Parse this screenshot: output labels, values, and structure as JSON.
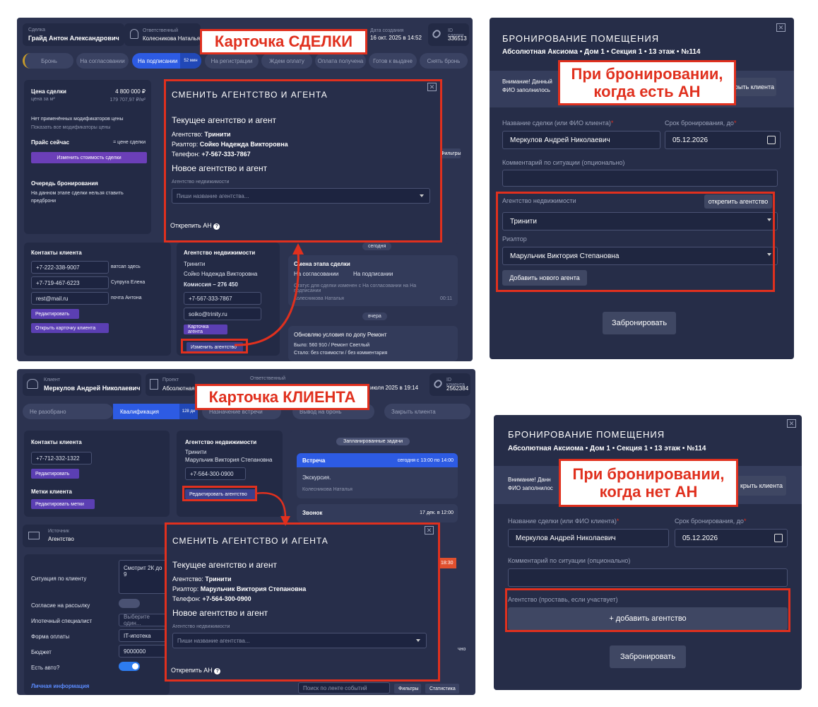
{
  "callouts": {
    "deal": "Карточка СДЕЛКИ",
    "client": "Карточка КЛИЕНТА",
    "with_an": "При бронировании,\nкогда есть АН",
    "without_an": "При бронировании,\nкогда нет АН"
  },
  "deal": {
    "header": {
      "deal_label": "Сделка",
      "deal_name": "Грайд Антон Александрович",
      "resp_label": "Ответственный",
      "resp_name": "Колесникова Наталья",
      "created_label": "Дата создания",
      "created": "16 окт. 2025 в 14:52",
      "id_label": "ID сделки",
      "id": "336513"
    },
    "stages": [
      "Бронь",
      "На согласовании",
      "На подписании",
      "52 мин",
      "На регистрации",
      "Ждем оплату",
      "Оплата получена",
      "Готов к выдаче",
      "Снять бронь"
    ],
    "price": {
      "title": "Цена сделки",
      "value": "4 800 000 ₽",
      "sub": "цена за м²",
      "per_m": "179 707,97 ₽/м²",
      "no_mod": "Нет применённых модификаторов цены",
      "show_mod": "Показать все модификаторы цены",
      "now": "Прайс сейчас",
      "now_val": "= цене сделки",
      "change_btn": "Изменить стоимость сделки"
    },
    "queue": {
      "title": "Очередь бронирования",
      "text": "На данном этапе сделки нельзя ставить предброни"
    },
    "contacts": {
      "title": "Контакты клиента",
      "rows": [
        {
          "v": "+7-222-338-9007",
          "n": "ватсап здесь"
        },
        {
          "v": "+7-719-467-6223",
          "n": "Супруга Елена"
        },
        {
          "v": "rest@mail.ru",
          "n": "почта Антона"
        }
      ],
      "edit": "Редактировать",
      "open": "Открыть карточку клиента"
    },
    "agency": {
      "title": "Агентство недвижимости",
      "name": "Тринити",
      "agent": "Сойко Надежда Викторовна",
      "commission": "Комиссия – 276 450",
      "phone": "+7-567-333-7867",
      "email": "soiko@trinity.ru",
      "card_btn": "Карточка агента",
      "change_btn": "Изменить агентство"
    },
    "feed": {
      "filters": "Фильтры",
      "today": "сегодня",
      "stage_title": "Смена этапа сделки",
      "from": "На согласовании",
      "to": "На подписании",
      "status": "Статус для сделки изменен с На согласовании на На подписании",
      "who": "Колесникова Наталья",
      "time": "00:11",
      "yesterday": "вчера",
      "upd": "Обновляю условия по допу Ремонт",
      "was": "Было: 560 910 / Ремонт Светлый",
      "now": "Стало: без стоимости / без комментария"
    },
    "modal": {
      "title": "СМЕНИТЬ АГЕНТСТВО И АГЕНТА",
      "cur": "Текущее агентство и агент",
      "agency": "Агентство:",
      "agency_v": "Тринити",
      "agent": "Риэлтор:",
      "agent_v": "Сойко Надежда Викторовна",
      "phone": "Телефон:",
      "phone_v": "+7-567-333-7867",
      "new": "Новое агентство и агент",
      "field_label": "Агентство недвижимости",
      "placeholder": "Пиши название агентства...",
      "unpin": "Открепить АН"
    }
  },
  "client": {
    "header": {
      "client_label": "Клиент",
      "client_name": "Меркулов Андрей Николаевич",
      "project_label": "Проект",
      "project": "Абсолютная",
      "resp_label": "Ответственный",
      "created": "июля 2025 в 19:14",
      "id_label": "ID клиента",
      "id": "2562384"
    },
    "stages": [
      "Не разобрано",
      "Квалификация",
      "128 дн",
      "Назначение встречи",
      "Вывод на бронь",
      "Закрыть клиента"
    ],
    "contacts": {
      "title": "Контакты клиента",
      "phone": "+7-712-332-1322",
      "edit": "Редактировать",
      "tags": "Метки клиента",
      "edit_tags": "Редактировать метки"
    },
    "agency": {
      "title": "Агентство недвижимости",
      "name": "Тринити",
      "agent": "Марульчик Виктория Степановна",
      "phone": "+7-564-300-0900",
      "edit_btn": "Редактировать агентство"
    },
    "tasks": {
      "header": "Запланированные задачи",
      "meet": "Встреча",
      "meet_time": "сегодня с 13:00 по 14:00",
      "meet_text": "Экскурсия.",
      "meet_who": "Колесникова Наталья",
      "call": "Звонок",
      "call_time": "17 дек. в 12:00",
      "late": "18:30"
    },
    "source": {
      "label": "Источник",
      "value": "Агентство"
    },
    "form": {
      "situation": "Ситуация по клиенту",
      "situation_v": "Смотрит 2К до 9",
      "mail": "Согласие на рассылку",
      "mortgage": "Ипотечный специалист",
      "mortgage_ph": "Выберите один...",
      "pay": "Форма оплаты",
      "pay_v": "IT-ипотека",
      "budget": "Бюджет",
      "budget_v": "9000000",
      "car": "Есть авто?",
      "personal": "Личная информация"
    },
    "feed": {
      "search": "Поиск по ленте событий",
      "filters": "Фильтры",
      "stats": "Статистика",
      "chno": "чно"
    },
    "modal": {
      "title": "СМЕНИТЬ АГЕНТСТВО И АГЕНТА",
      "cur": "Текущее агентство и агент",
      "agency": "Агентство:",
      "agency_v": "Тринити",
      "agent": "Риэлтор:",
      "agent_v": "Марульчик Виктория Степановна",
      "phone": "Телефон:",
      "phone_v": "+7-564-300-0900",
      "new": "Новое агентство и агент",
      "field_label": "Агентство недвижимости",
      "placeholder": "Пиши название агентства...",
      "unpin": "Открепить АН"
    }
  },
  "booking1": {
    "title": "БРОНИРОВАНИЕ ПОМЕЩЕНИЯ",
    "sub": "Абсолютная Аксиома • Дом 1 • Секция 1 • 13 этаж • №114",
    "warn": "Внимание! Данный\nФИО заполнилось",
    "warn_btn": "крыть клиента",
    "name_label": "Название сделки (или ФИО клиента)",
    "name_v": "Меркулов Андрей Николаевич",
    "date_label": "Срок бронирования, до",
    "date_v": "05.12.2026",
    "comment": "Комментарий по ситуации (опционально)",
    "agency_label": "Агентство недвижимости",
    "unpin_btn": "открепить агентство",
    "agency_v": "Тринити",
    "agent_label": "Риэлтор",
    "agent_v": "Марульчик Виктория Степановна",
    "add_agent": "Добавить нового агента",
    "submit": "Забронировать"
  },
  "booking2": {
    "title": "БРОНИРОВАНИЕ ПОМЕЩЕНИЯ",
    "sub": "Абсолютная Аксиома • Дом 1 • Секция 1 • 13 этаж • №114",
    "warn": "Внимание! Данн\nФИО заполнилос",
    "warn_btn": "крыть клиента",
    "name_label": "Название сделки (или ФИО клиента)",
    "name_v": "Меркулов Андрей Николаевич",
    "date_label": "Срок бронирования, до",
    "date_v": "05.12.2026",
    "comment": "Комментарий по ситуации (опционально)",
    "agency_label": "Агентство (проставь, если участвует)",
    "add_agency": "+ добавить агентство",
    "submit": "Забронировать"
  }
}
